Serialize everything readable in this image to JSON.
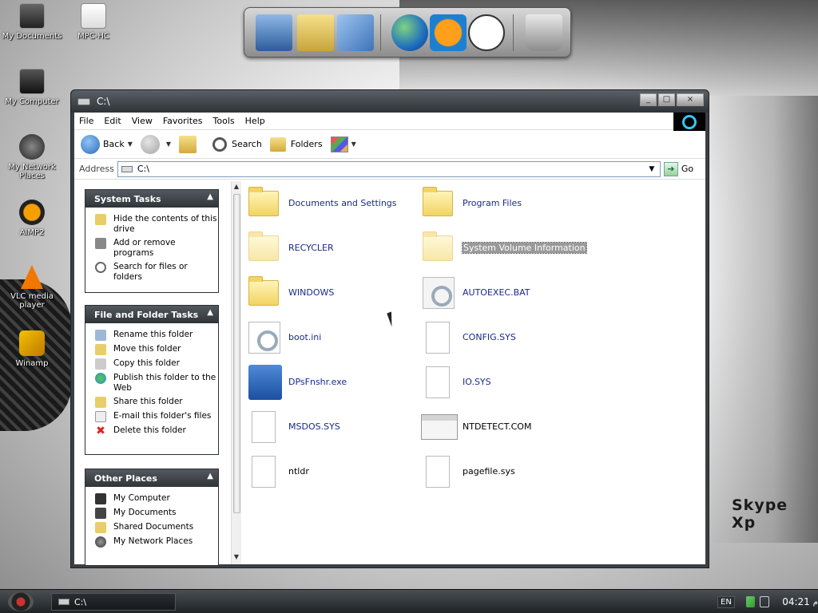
{
  "desktop": {
    "icons": [
      {
        "label": "My Documents",
        "icon": "my-documents-icon"
      },
      {
        "label": "MPC-HC",
        "icon": "mpc-hc-icon"
      },
      {
        "label": "My Computer",
        "icon": "my-computer-icon"
      },
      {
        "label": "My Network Places",
        "icon": "network-places-icon"
      },
      {
        "label": "AIMP2",
        "icon": "aimp2-icon"
      },
      {
        "label": "VLC media player",
        "icon": "vlc-icon"
      },
      {
        "label": "Winamp",
        "icon": "winamp-icon"
      }
    ],
    "wallpaper_text": "Skype Xp"
  },
  "dock": {
    "items": [
      "my-computer-icon",
      "documents-icon",
      "control-panel-icon",
      "internet-globe-icon",
      "media-player-icon",
      "clock-icon",
      "recycle-bin-icon"
    ]
  },
  "window": {
    "title": "C:\\",
    "buttons": {
      "minimize": "_",
      "maximize": "□",
      "close": "×"
    },
    "menu": [
      "File",
      "Edit",
      "View",
      "Favorites",
      "Tools",
      "Help"
    ],
    "toolbar": {
      "back": "Back",
      "search": "Search",
      "folders": "Folders"
    },
    "address": {
      "label": "Address",
      "value": "C:\\",
      "go": "Go"
    },
    "panels": [
      {
        "title": "System Tasks",
        "items": [
          {
            "label": "Hide the contents of this drive",
            "icon": "hide-drive-icon"
          },
          {
            "label": "Add or remove programs",
            "icon": "add-remove-programs-icon"
          },
          {
            "label": "Search for files or folders",
            "icon": "search-icon"
          }
        ]
      },
      {
        "title": "File and Folder Tasks",
        "items": [
          {
            "label": "Rename this folder",
            "icon": "rename-icon"
          },
          {
            "label": "Move this folder",
            "icon": "move-icon"
          },
          {
            "label": "Copy this folder",
            "icon": "copy-icon"
          },
          {
            "label": "Publish this folder to the Web",
            "icon": "publish-web-icon"
          },
          {
            "label": "Share this folder",
            "icon": "share-icon"
          },
          {
            "label": "E-mail this folder's files",
            "icon": "email-icon"
          },
          {
            "label": "Delete this folder",
            "icon": "delete-icon"
          }
        ]
      },
      {
        "title": "Other Places",
        "items": [
          {
            "label": "My Computer",
            "icon": "my-computer-icon"
          },
          {
            "label": "My Documents",
            "icon": "my-documents-icon"
          },
          {
            "label": "Shared Documents",
            "icon": "shared-documents-icon"
          },
          {
            "label": "My Network Places",
            "icon": "network-places-icon"
          }
        ]
      }
    ],
    "files": [
      {
        "name": "Documents and Settings",
        "type": "folder"
      },
      {
        "name": "Program Files",
        "type": "folder"
      },
      {
        "name": "RECYCLER",
        "type": "folder-hidden"
      },
      {
        "name": "System Volume Information",
        "type": "folder-hidden",
        "selected": true
      },
      {
        "name": "WINDOWS",
        "type": "folder"
      },
      {
        "name": "AUTOEXEC.BAT",
        "type": "settings-file"
      },
      {
        "name": "boot.ini",
        "type": "settings-file"
      },
      {
        "name": "CONFIG.SYS",
        "type": "file"
      },
      {
        "name": "DPsFnshr.exe",
        "type": "exe"
      },
      {
        "name": "IO.SYS",
        "type": "file"
      },
      {
        "name": "MSDOS.SYS",
        "type": "file"
      },
      {
        "name": "NTDETECT.COM",
        "type": "com"
      },
      {
        "name": "ntldr",
        "type": "file"
      },
      {
        "name": "pagefile.sys",
        "type": "file"
      }
    ]
  },
  "taskbar": {
    "task_label": "C:\\",
    "language": "EN",
    "time": "04:21",
    "ampm": "م"
  }
}
